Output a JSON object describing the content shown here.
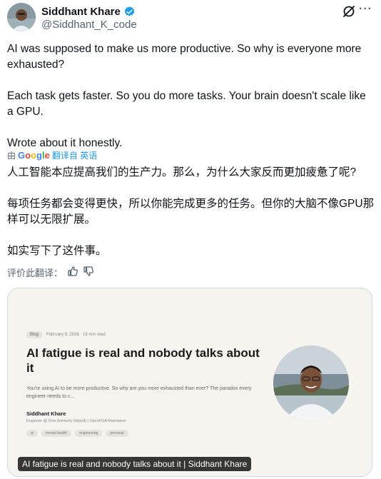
{
  "author": {
    "name": "Siddhant Khare",
    "handle": "@Siddhant_K_code",
    "verified": true
  },
  "icons": {
    "verified": "verified-badge-icon",
    "grok": "grok-icon",
    "more": "more-options-icon",
    "thumbs_up": "thumbs-up-icon",
    "thumbs_down": "thumbs-down-icon"
  },
  "tweet": {
    "paragraphs": [
      "AI was supposed to make us more productive. So why is everyone more exhausted?",
      "Each task gets faster. So you do more tasks. Your brain doesn't scale like a GPU.",
      "Wrote about it honestly."
    ]
  },
  "translation": {
    "by_label": "由",
    "provider": "Google",
    "action": "翻译自 英语",
    "paragraphs": [
      "人工智能本应提高我们的生产力。那么，为什么大家反而更加疲惫了呢?",
      "每项任务都会变得更快，所以你能完成更多的任务。但你的大脑不像GPU那样可以无限扩展。",
      "如实写下了这件事。"
    ],
    "rate_label": "评价此翻译："
  },
  "card": {
    "blog_tag": "Blog",
    "blog_meta": "February 8, 2026 · 18 min read",
    "title": "AI fatigue is real and nobody talks about it",
    "description": "You're using AI to be more productive. So why are you more exhausted than ever? The paradox every engineer needs to c...",
    "author_name": "Siddhant Khare",
    "author_role": "Engineer @ Ona (formerly Gitpod) | OpenFGA Maintainer",
    "tags": [
      "ai",
      "mental-health",
      "engineering",
      "personal"
    ],
    "caption": "AI fatigue is real and nobody talks about it | Siddhant Khare"
  },
  "colors": {
    "text": "#0f1419",
    "muted": "#536471",
    "link": "#1d9bf0",
    "verified": "#1d9bf0",
    "card_bg": "#f6f4ef"
  }
}
